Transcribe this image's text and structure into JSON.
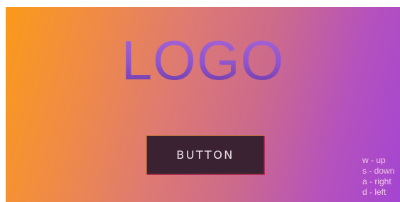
{
  "logo": {
    "text": "LOGO"
  },
  "button": {
    "label": "BUTTON"
  },
  "controls": [
    {
      "text": "w - up"
    },
    {
      "text": "s - down"
    },
    {
      "text": "a - right"
    },
    {
      "text": "d - left"
    }
  ],
  "colors": {
    "gradient_start": "#fb9a1a",
    "gradient_end": "#a445d2",
    "logo_purple": "#8f55cc",
    "button_bg": "#3a2232",
    "hint_text": "#f1c8e7"
  }
}
